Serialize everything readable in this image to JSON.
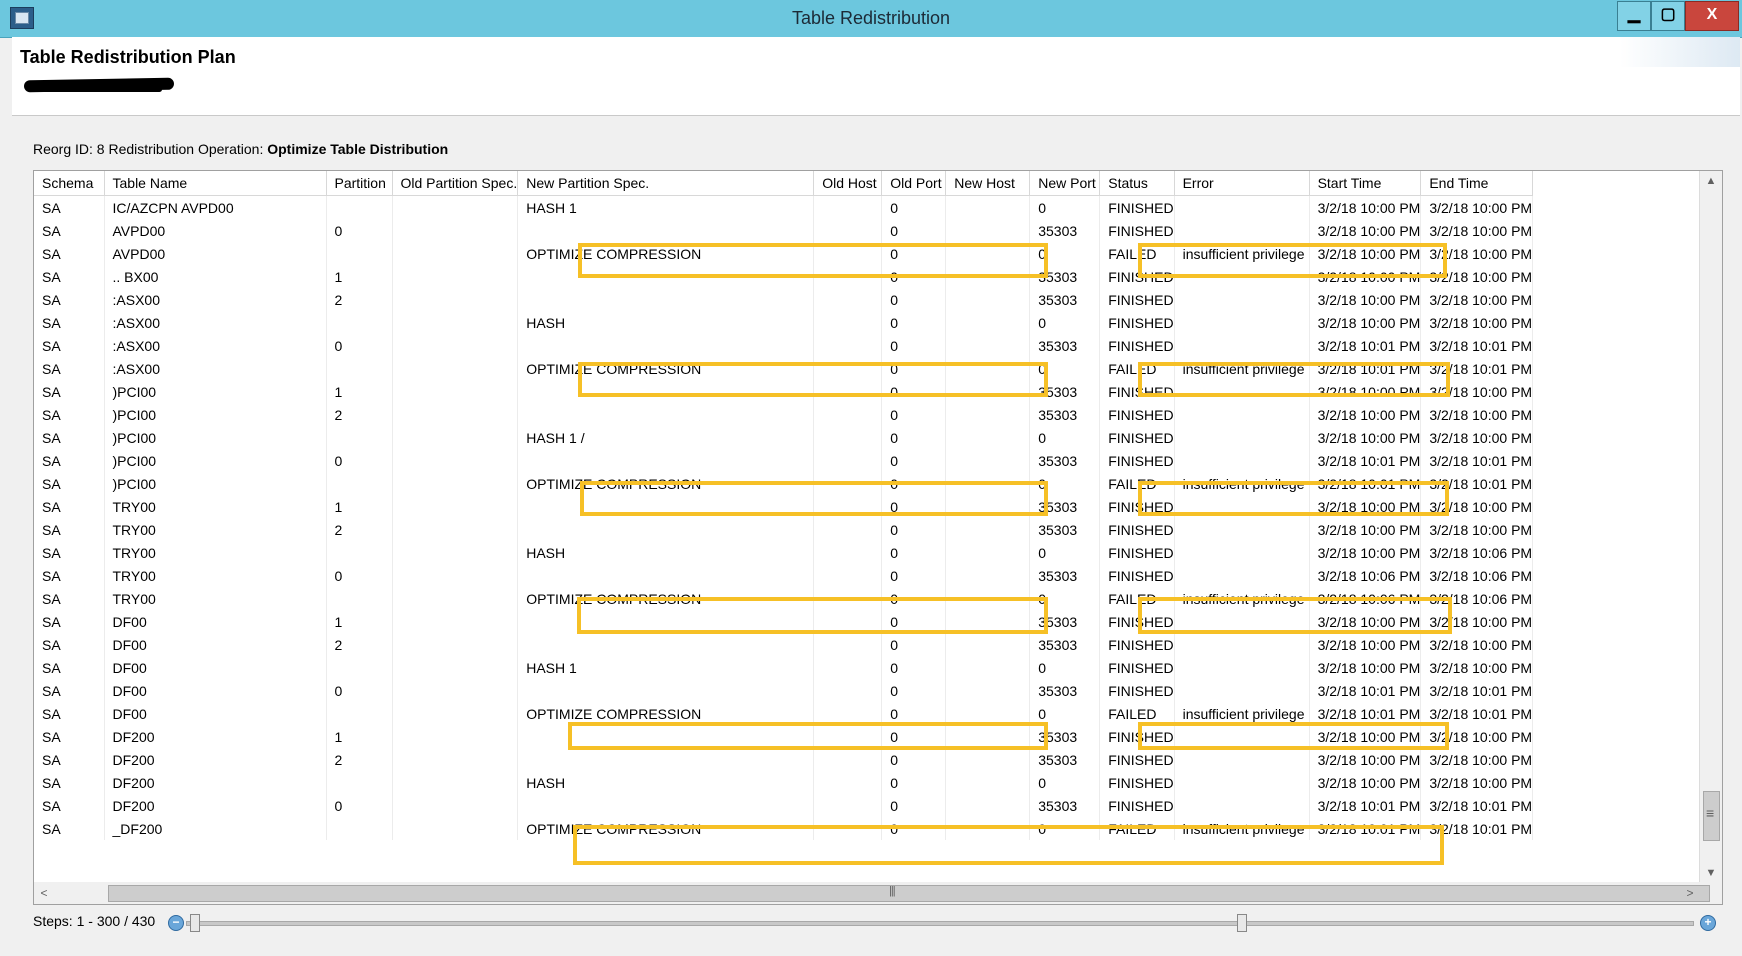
{
  "window": {
    "title": "Table Redistribution",
    "minimize_label": "▁",
    "maximize_label": "▢",
    "close_label": "X"
  },
  "header": {
    "plan_title": "Table Redistribution Plan"
  },
  "reorg": {
    "prefix": "Reorg ID: 8 Redistribution Operation: ",
    "operation": "Optimize Table Distribution"
  },
  "table": {
    "columns": [
      "Schema",
      "Table Name",
      "Partition",
      "Old Partition Spec.",
      "New Partition Spec.",
      "Old Host",
      "Old Port",
      "New Host",
      "New Port",
      "Status",
      "Error",
      "Start Time",
      "End Time"
    ],
    "rows": [
      [
        "SA",
        "IC/AZCPN AVPD00",
        "",
        "",
        "HASH 1",
        "",
        "0",
        "",
        "0",
        "FINISHED",
        "",
        "3/2/18 10:00 PM",
        "3/2/18 10:00 PM"
      ],
      [
        "SA",
        "AVPD00",
        "0",
        "",
        "",
        "",
        "0",
        "",
        "35303",
        "FINISHED",
        "",
        "3/2/18 10:00 PM",
        "3/2/18 10:00 PM"
      ],
      [
        "SA",
        "AVPD00",
        "",
        "",
        "OPTIMIZE COMPRESSION",
        "",
        "0",
        "",
        "0",
        "FAILED",
        "insufficient privilege",
        "3/2/18 10:00 PM",
        "3/2/18 10:00 PM"
      ],
      [
        "SA",
        ".. BX00",
        "1",
        "",
        "",
        "",
        "0",
        "",
        "35303",
        "FINISHED",
        "",
        "3/2/18 10:00 PM",
        "3/2/18 10:00 PM"
      ],
      [
        "SA",
        ":ASX00",
        "2",
        "",
        "",
        "",
        "0",
        "",
        "35303",
        "FINISHED",
        "",
        "3/2/18 10:00 PM",
        "3/2/18 10:00 PM"
      ],
      [
        "SA",
        ":ASX00",
        "",
        "",
        "HASH",
        "",
        "0",
        "",
        "0",
        "FINISHED",
        "",
        "3/2/18 10:00 PM",
        "3/2/18 10:00 PM"
      ],
      [
        "SA",
        ":ASX00",
        "0",
        "",
        "",
        "",
        "0",
        "",
        "35303",
        "FINISHED",
        "",
        "3/2/18 10:01 PM",
        "3/2/18 10:01 PM"
      ],
      [
        "SA",
        ":ASX00",
        "",
        "",
        "OPTIMIZE COMPRESSION",
        "",
        "0",
        "",
        "0",
        "FAILED",
        "insufficient privilege",
        "3/2/18 10:01 PM",
        "3/2/18 10:01 PM"
      ],
      [
        "SA",
        ")PCI00",
        "1",
        "",
        "",
        "",
        "0",
        "",
        "35303",
        "FINISHED",
        "",
        "3/2/18 10:00 PM",
        "3/2/18 10:00 PM"
      ],
      [
        "SA",
        ")PCI00",
        "2",
        "",
        "",
        "",
        "0",
        "",
        "35303",
        "FINISHED",
        "",
        "3/2/18 10:00 PM",
        "3/2/18 10:00 PM"
      ],
      [
        "SA",
        ")PCI00",
        "",
        "",
        "HASH 1 /",
        "",
        "0",
        "",
        "0",
        "FINISHED",
        "",
        "3/2/18 10:00 PM",
        "3/2/18 10:00 PM"
      ],
      [
        "SA",
        ")PCI00",
        "0",
        "",
        "",
        "",
        "0",
        "",
        "35303",
        "FINISHED",
        "",
        "3/2/18 10:01 PM",
        "3/2/18 10:01 PM"
      ],
      [
        "SA",
        ")PCI00",
        "",
        "",
        "OPTIMIZE COMPRESSION",
        "",
        "0",
        "",
        "0",
        "FAILED",
        "insufficient privilege",
        "3/2/18 10:01 PM",
        "3/2/18 10:01 PM"
      ],
      [
        "SA",
        "TRY00",
        "1",
        "",
        "",
        "",
        "0",
        "",
        "35303",
        "FINISHED",
        "",
        "3/2/18 10:00 PM",
        "3/2/18 10:00 PM"
      ],
      [
        "SA",
        "TRY00",
        "2",
        "",
        "",
        "",
        "0",
        "",
        "35303",
        "FINISHED",
        "",
        "3/2/18 10:00 PM",
        "3/2/18 10:00 PM"
      ],
      [
        "SA",
        "TRY00",
        "",
        "",
        "HASH",
        "",
        "0",
        "",
        "0",
        "FINISHED",
        "",
        "3/2/18 10:00 PM",
        "3/2/18 10:06 PM"
      ],
      [
        "SA",
        "TRY00",
        "0",
        "",
        "",
        "",
        "0",
        "",
        "35303",
        "FINISHED",
        "",
        "3/2/18 10:06 PM",
        "3/2/18 10:06 PM"
      ],
      [
        "SA",
        "TRY00",
        "",
        "",
        "OPTIMIZE COMPRESSION",
        "",
        "0",
        "",
        "0",
        "FAILED",
        "insufficient privilege",
        "3/2/18 10:06 PM",
        "3/2/18 10:06 PM"
      ],
      [
        "SA",
        "DF00",
        "1",
        "",
        "",
        "",
        "0",
        "",
        "35303",
        "FINISHED",
        "",
        "3/2/18 10:00 PM",
        "3/2/18 10:00 PM"
      ],
      [
        "SA",
        "DF00",
        "2",
        "",
        "",
        "",
        "0",
        "",
        "35303",
        "FINISHED",
        "",
        "3/2/18 10:00 PM",
        "3/2/18 10:00 PM"
      ],
      [
        "SA",
        "DF00",
        "",
        "",
        "HASH 1",
        "",
        "0",
        "",
        "0",
        "FINISHED",
        "",
        "3/2/18 10:00 PM",
        "3/2/18 10:00 PM"
      ],
      [
        "SA",
        "DF00",
        "0",
        "",
        "",
        "",
        "0",
        "",
        "35303",
        "FINISHED",
        "",
        "3/2/18 10:01 PM",
        "3/2/18 10:01 PM"
      ],
      [
        "SA",
        "DF00",
        "",
        "",
        "OPTIMIZE COMPRESSION",
        "",
        "0",
        "",
        "0",
        "FAILED",
        "insufficient privilege",
        "3/2/18 10:01 PM",
        "3/2/18 10:01 PM"
      ],
      [
        "SA",
        "DF200",
        "1",
        "",
        "",
        "",
        "0",
        "",
        "35303",
        "FINISHED",
        "",
        "3/2/18 10:00 PM",
        "3/2/18 10:00 PM"
      ],
      [
        "SA",
        "DF200",
        "2",
        "",
        "",
        "",
        "0",
        "",
        "35303",
        "FINISHED",
        "",
        "3/2/18 10:00 PM",
        "3/2/18 10:00 PM"
      ],
      [
        "SA",
        "DF200",
        "",
        "",
        "HASH",
        "",
        "0",
        "",
        "0",
        "FINISHED",
        "",
        "3/2/18 10:00 PM",
        "3/2/18 10:00 PM"
      ],
      [
        "SA",
        "DF200",
        "0",
        "",
        "",
        "",
        "0",
        "",
        "35303",
        "FINISHED",
        "",
        "3/2/18 10:01 PM",
        "3/2/18 10:01 PM"
      ],
      [
        "SA",
        "_DF200",
        "",
        "",
        "OPTIMIZE COMPRESSION",
        "",
        "0",
        "",
        "0",
        "FAILED",
        "insufficient privilege",
        "3/2/18 10:01 PM",
        "3/2/18 10:01 PM"
      ]
    ]
  },
  "scroll": {
    "up_icon": "chevron-up-icon",
    "down_icon": "chevron-down-icon",
    "left_icon": "chevron-left-icon",
    "right_icon": "chevron-right-icon"
  },
  "footer": {
    "steps_label": "Steps:",
    "steps_range": "1 - 300 / 430"
  },
  "colors": {
    "highlight": "#f6c026",
    "titlebar": "#6cc7de"
  }
}
